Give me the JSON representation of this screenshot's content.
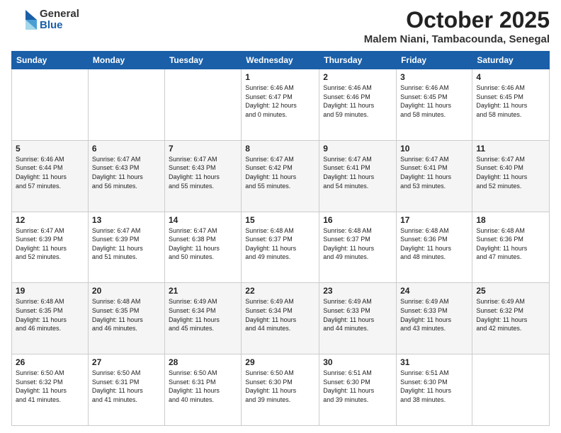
{
  "header": {
    "logo_general": "General",
    "logo_blue": "Blue",
    "month_title": "October 2025",
    "location": "Malem Niani, Tambacounda, Senegal"
  },
  "weekdays": [
    "Sunday",
    "Monday",
    "Tuesday",
    "Wednesday",
    "Thursday",
    "Friday",
    "Saturday"
  ],
  "weeks": [
    [
      {
        "day": "",
        "info": ""
      },
      {
        "day": "",
        "info": ""
      },
      {
        "day": "",
        "info": ""
      },
      {
        "day": "1",
        "info": "Sunrise: 6:46 AM\nSunset: 6:47 PM\nDaylight: 12 hours\nand 0 minutes."
      },
      {
        "day": "2",
        "info": "Sunrise: 6:46 AM\nSunset: 6:46 PM\nDaylight: 11 hours\nand 59 minutes."
      },
      {
        "day": "3",
        "info": "Sunrise: 6:46 AM\nSunset: 6:45 PM\nDaylight: 11 hours\nand 58 minutes."
      },
      {
        "day": "4",
        "info": "Sunrise: 6:46 AM\nSunset: 6:45 PM\nDaylight: 11 hours\nand 58 minutes."
      }
    ],
    [
      {
        "day": "5",
        "info": "Sunrise: 6:46 AM\nSunset: 6:44 PM\nDaylight: 11 hours\nand 57 minutes."
      },
      {
        "day": "6",
        "info": "Sunrise: 6:47 AM\nSunset: 6:43 PM\nDaylight: 11 hours\nand 56 minutes."
      },
      {
        "day": "7",
        "info": "Sunrise: 6:47 AM\nSunset: 6:43 PM\nDaylight: 11 hours\nand 55 minutes."
      },
      {
        "day": "8",
        "info": "Sunrise: 6:47 AM\nSunset: 6:42 PM\nDaylight: 11 hours\nand 55 minutes."
      },
      {
        "day": "9",
        "info": "Sunrise: 6:47 AM\nSunset: 6:41 PM\nDaylight: 11 hours\nand 54 minutes."
      },
      {
        "day": "10",
        "info": "Sunrise: 6:47 AM\nSunset: 6:41 PM\nDaylight: 11 hours\nand 53 minutes."
      },
      {
        "day": "11",
        "info": "Sunrise: 6:47 AM\nSunset: 6:40 PM\nDaylight: 11 hours\nand 52 minutes."
      }
    ],
    [
      {
        "day": "12",
        "info": "Sunrise: 6:47 AM\nSunset: 6:39 PM\nDaylight: 11 hours\nand 52 minutes."
      },
      {
        "day": "13",
        "info": "Sunrise: 6:47 AM\nSunset: 6:39 PM\nDaylight: 11 hours\nand 51 minutes."
      },
      {
        "day": "14",
        "info": "Sunrise: 6:47 AM\nSunset: 6:38 PM\nDaylight: 11 hours\nand 50 minutes."
      },
      {
        "day": "15",
        "info": "Sunrise: 6:48 AM\nSunset: 6:37 PM\nDaylight: 11 hours\nand 49 minutes."
      },
      {
        "day": "16",
        "info": "Sunrise: 6:48 AM\nSunset: 6:37 PM\nDaylight: 11 hours\nand 49 minutes."
      },
      {
        "day": "17",
        "info": "Sunrise: 6:48 AM\nSunset: 6:36 PM\nDaylight: 11 hours\nand 48 minutes."
      },
      {
        "day": "18",
        "info": "Sunrise: 6:48 AM\nSunset: 6:36 PM\nDaylight: 11 hours\nand 47 minutes."
      }
    ],
    [
      {
        "day": "19",
        "info": "Sunrise: 6:48 AM\nSunset: 6:35 PM\nDaylight: 11 hours\nand 46 minutes."
      },
      {
        "day": "20",
        "info": "Sunrise: 6:48 AM\nSunset: 6:35 PM\nDaylight: 11 hours\nand 46 minutes."
      },
      {
        "day": "21",
        "info": "Sunrise: 6:49 AM\nSunset: 6:34 PM\nDaylight: 11 hours\nand 45 minutes."
      },
      {
        "day": "22",
        "info": "Sunrise: 6:49 AM\nSunset: 6:34 PM\nDaylight: 11 hours\nand 44 minutes."
      },
      {
        "day": "23",
        "info": "Sunrise: 6:49 AM\nSunset: 6:33 PM\nDaylight: 11 hours\nand 44 minutes."
      },
      {
        "day": "24",
        "info": "Sunrise: 6:49 AM\nSunset: 6:33 PM\nDaylight: 11 hours\nand 43 minutes."
      },
      {
        "day": "25",
        "info": "Sunrise: 6:49 AM\nSunset: 6:32 PM\nDaylight: 11 hours\nand 42 minutes."
      }
    ],
    [
      {
        "day": "26",
        "info": "Sunrise: 6:50 AM\nSunset: 6:32 PM\nDaylight: 11 hours\nand 41 minutes."
      },
      {
        "day": "27",
        "info": "Sunrise: 6:50 AM\nSunset: 6:31 PM\nDaylight: 11 hours\nand 41 minutes."
      },
      {
        "day": "28",
        "info": "Sunrise: 6:50 AM\nSunset: 6:31 PM\nDaylight: 11 hours\nand 40 minutes."
      },
      {
        "day": "29",
        "info": "Sunrise: 6:50 AM\nSunset: 6:30 PM\nDaylight: 11 hours\nand 39 minutes."
      },
      {
        "day": "30",
        "info": "Sunrise: 6:51 AM\nSunset: 6:30 PM\nDaylight: 11 hours\nand 39 minutes."
      },
      {
        "day": "31",
        "info": "Sunrise: 6:51 AM\nSunset: 6:30 PM\nDaylight: 11 hours\nand 38 minutes."
      },
      {
        "day": "",
        "info": ""
      }
    ]
  ]
}
